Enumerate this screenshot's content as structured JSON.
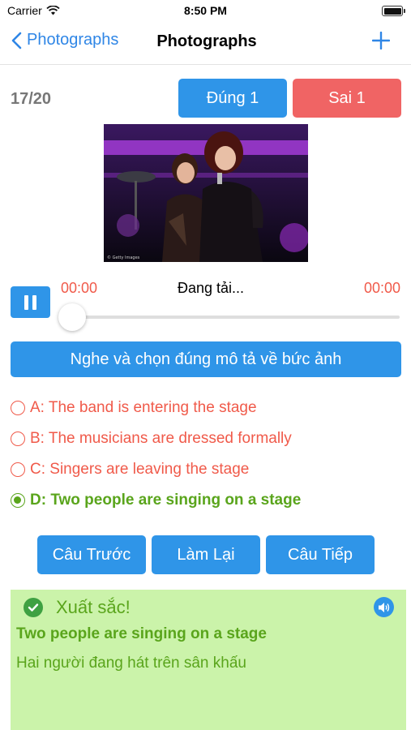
{
  "status_bar": {
    "carrier": "Carrier",
    "time": "8:50 PM"
  },
  "nav": {
    "back_label": "Photographs",
    "title": "Photographs"
  },
  "quiz": {
    "counter": "17/20",
    "correct_label": "Đúng 1",
    "wrong_label": "Sai 1",
    "photo_caption": "© Getty Images"
  },
  "player": {
    "elapsed": "00:00",
    "status": "Đang tải...",
    "duration": "00:00",
    "progress": 0
  },
  "instruction": "Nghe và chọn đúng mô tả về bức ảnh",
  "options": [
    {
      "label": "A: The band is entering the stage",
      "state": "wrong"
    },
    {
      "label": "B: The musicians are dressed formally",
      "state": "wrong"
    },
    {
      "label": "C: Singers are leaving the stage",
      "state": "wrong"
    },
    {
      "label": "D: Two people are singing on a stage",
      "state": "correct-selected"
    }
  ],
  "buttons": {
    "prev": "Câu Trước",
    "retry": "Làm Lại",
    "next": "Câu Tiếp"
  },
  "result": {
    "title": "Xuất sắc!",
    "answer_en": "Two people are singing on a stage",
    "answer_vi": "Hai người đang hát trên sân khấu"
  },
  "colors": {
    "accent": "#2f95e8",
    "wrong": "#f05a4a",
    "correct": "#5aa51c",
    "result_bg": "#cbf3aa"
  },
  "icons": [
    "wifi-icon",
    "battery-icon",
    "chevron-left-icon",
    "plus-icon",
    "pause-icon",
    "check-circle-icon",
    "speaker-icon"
  ]
}
